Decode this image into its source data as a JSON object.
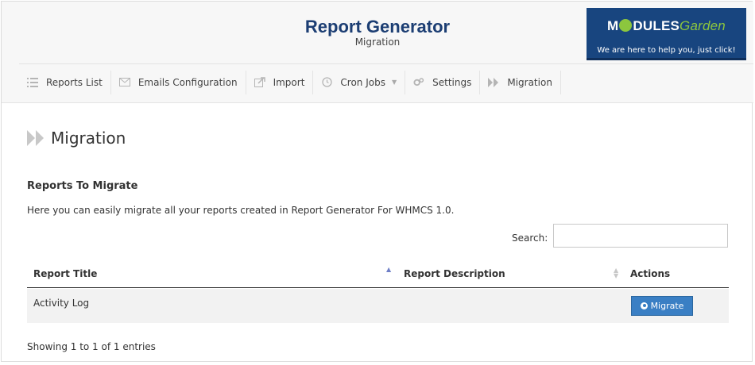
{
  "header": {
    "title": "Report Generator",
    "subtitle": "Migration"
  },
  "brand": {
    "logo_prefix": "M",
    "logo_mid": "DULES",
    "logo_suffix": "Garden",
    "tagline": "We are here to help you, just click!",
    "color": "#18457f",
    "accent": "#8cc63e"
  },
  "nav": {
    "items": [
      {
        "label": "Reports List",
        "icon": "list-icon"
      },
      {
        "label": "Emails Configuration",
        "icon": "envelope-icon"
      },
      {
        "label": "Import",
        "icon": "import-icon"
      },
      {
        "label": "Cron Jobs",
        "icon": "clock-icon"
      },
      {
        "label": "Settings",
        "icon": "gears-icon"
      },
      {
        "label": "Migration",
        "icon": "forward-icon"
      }
    ]
  },
  "page": {
    "heading": "Migration",
    "section_title": "Reports To Migrate",
    "description": "Here you can easily migrate all your reports created in Report Generator For WHMCS 1.0."
  },
  "search": {
    "label": "Search:",
    "value": ""
  },
  "table": {
    "columns": [
      "Report Title",
      "Report Description",
      "Actions"
    ],
    "rows": [
      {
        "title": "Activity Log",
        "description": "",
        "action": "Migrate"
      }
    ],
    "info": "Showing 1 to 1 of 1 entries"
  }
}
